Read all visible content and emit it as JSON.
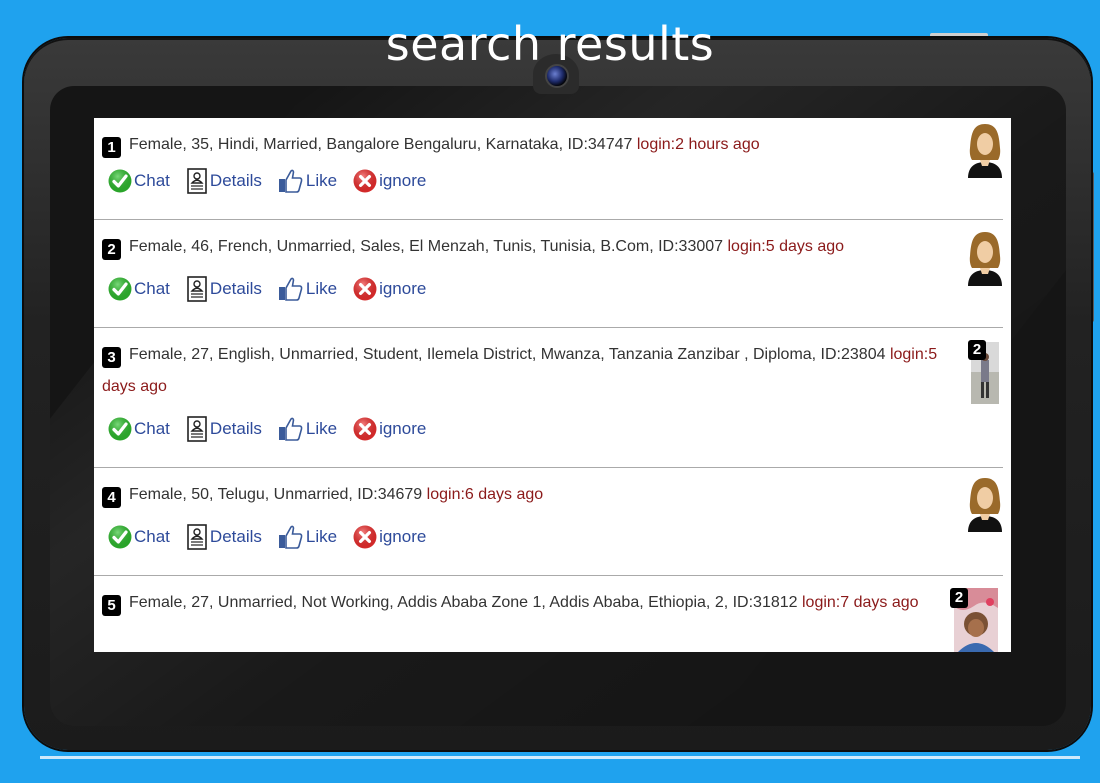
{
  "header": {
    "title": "search results"
  },
  "actions": {
    "chat": "Chat",
    "details": "Details",
    "like": "Like",
    "ignore": "ignore"
  },
  "results": [
    {
      "number": "1",
      "info": "Female, 35, Hindi, Married, Bangalore Bengaluru, Karnataka, ID:34747",
      "login": "login:2 hours ago"
    },
    {
      "number": "2",
      "info": "Female, 46, French, Unmarried, Sales, El Menzah, Tunis, Tunisia, B.Com, ID:33007",
      "login": "login:5 days ago"
    },
    {
      "number": "3",
      "info": "Female, 27, English, Unmarried, Student, Ilemela District, Mwanza, Tanzania Zanzibar , Diploma, ID:23804",
      "login": "login:5 days ago",
      "photo_count": "2"
    },
    {
      "number": "4",
      "info": "Female, 50, Telugu, Unmarried, ID:34679",
      "login": "login:6 days ago"
    },
    {
      "number": "5",
      "info": "Female, 27, Unmarried, Not Working, Addis Ababa Zone 1, Addis Ababa, Ethiopia, 2, ID:31812",
      "login": "login:7 days ago",
      "photo_count": "2"
    }
  ],
  "icons": {
    "chat": "check-circle-icon",
    "details": "profile-document-icon",
    "like": "thumbs-up-icon",
    "ignore": "x-circle-icon"
  },
  "colors": {
    "background": "#1fa2ee",
    "login_text": "#8b1a1a",
    "action_text": "#2d4a9a"
  }
}
